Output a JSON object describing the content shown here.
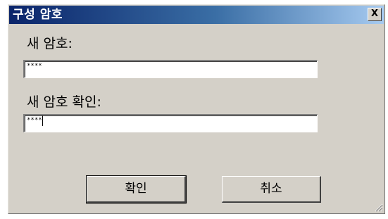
{
  "dialog": {
    "title": "구성 암호",
    "close_label": "X"
  },
  "form": {
    "new_password_label": "새 암호:",
    "new_password_value": "****",
    "confirm_password_label": "새 암호 확인:",
    "confirm_password_value": "****"
  },
  "buttons": {
    "ok_label": "확인",
    "cancel_label": "취소"
  },
  "colors": {
    "titlebar_start": "#0a246a",
    "titlebar_end": "#a6caf0",
    "dialog_face": "#d4d0c8"
  }
}
